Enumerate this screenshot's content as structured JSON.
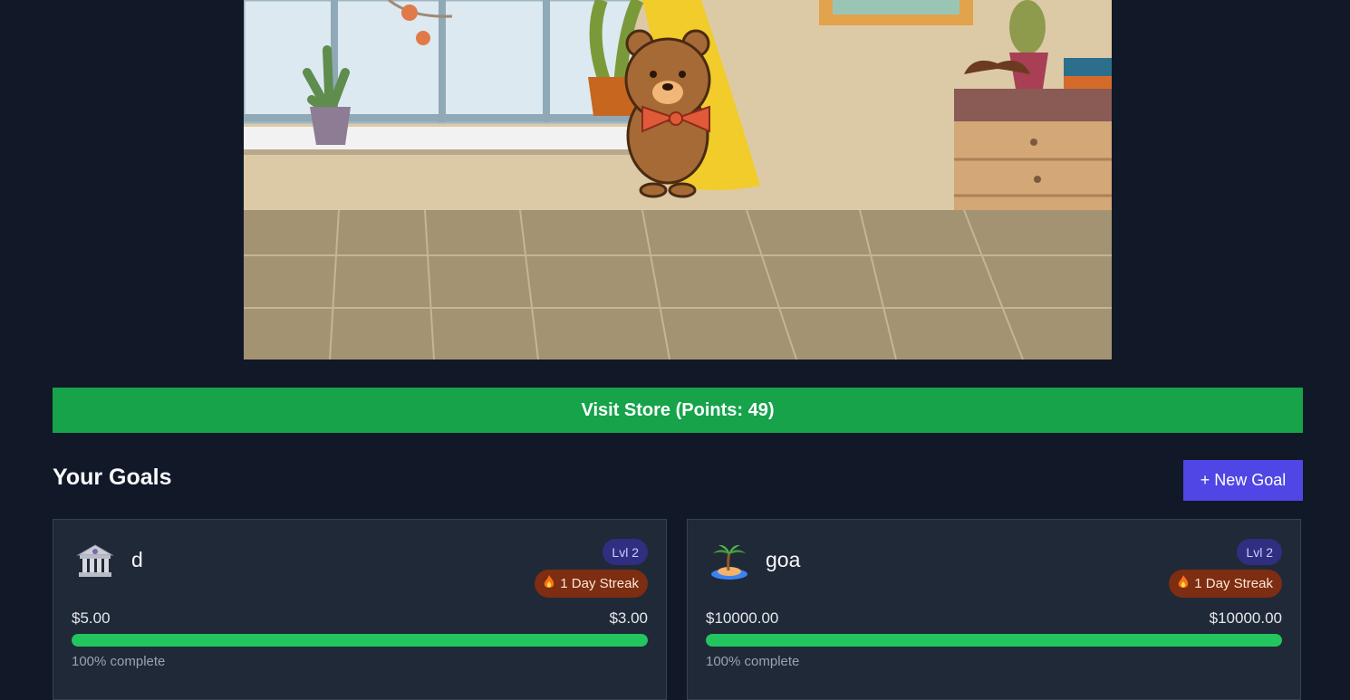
{
  "store": {
    "label": "Visit Store (Points: 49)"
  },
  "goals_section": {
    "title": "Your Goals",
    "new_goal_label": "+ New Goal"
  },
  "goals": [
    {
      "icon": "bank-icon",
      "name": "d",
      "level": "Lvl 2",
      "streak": "1 Day Streak",
      "amount_left": "$5.00",
      "amount_right": "$3.00",
      "progress": 1.0,
      "progress_text": "100% complete"
    },
    {
      "icon": "palm-island-icon",
      "name": "goa",
      "level": "Lvl 2",
      "streak": "1 Day Streak",
      "amount_left": "$10000.00",
      "amount_right": "$10000.00",
      "progress": 1.0,
      "progress_text": "100% complete"
    }
  ],
  "colors": {
    "background": "#111827",
    "store_green": "#16a34a",
    "accent": "#4f46e5",
    "progress": "#22c55e",
    "streak": "#7c2d12",
    "level": "#312e81"
  }
}
